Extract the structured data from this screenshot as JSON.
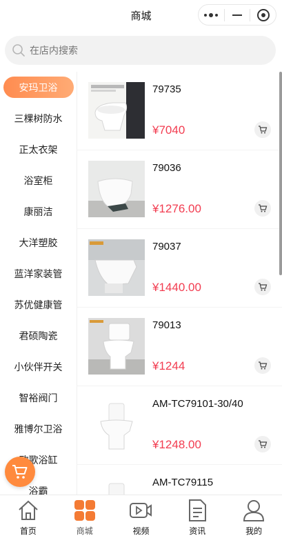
{
  "header": {
    "title": "商城"
  },
  "search": {
    "placeholder": "在店内搜索"
  },
  "sidebar": {
    "items": [
      {
        "label": "安玛卫浴",
        "active": true
      },
      {
        "label": "三棵树防水"
      },
      {
        "label": "正太衣架"
      },
      {
        "label": "浴室柜"
      },
      {
        "label": "康丽洁"
      },
      {
        "label": "大洋塑胶"
      },
      {
        "label": "蓝洋家装管"
      },
      {
        "label": "苏优健康管"
      },
      {
        "label": "君硕陶瓷"
      },
      {
        "label": "小伙伴开关"
      },
      {
        "label": "智裕阀门"
      },
      {
        "label": "雅博尔卫浴"
      },
      {
        "label": "欧歌浴缸"
      },
      {
        "label": "浴霸"
      }
    ]
  },
  "products": [
    {
      "name": "79735",
      "price": "¥7040"
    },
    {
      "name": "79036",
      "price": "¥1276.00"
    },
    {
      "name": "79037",
      "price": "¥1440.00"
    },
    {
      "name": "79013",
      "price": "¥1244"
    },
    {
      "name": "AM-TC79101-30/40",
      "price": "¥1248.00"
    },
    {
      "name": "AM-TC79115",
      "price": ""
    }
  ],
  "tabbar": {
    "items": [
      {
        "label": "首页",
        "icon": "home-icon"
      },
      {
        "label": "商城",
        "icon": "grid-icon",
        "active": true
      },
      {
        "label": "视频",
        "icon": "video-icon"
      },
      {
        "label": "资讯",
        "icon": "document-icon"
      },
      {
        "label": "我的",
        "icon": "user-icon"
      }
    ]
  },
  "colors": {
    "accent": "#ff8a3d",
    "price": "#f23c50"
  }
}
